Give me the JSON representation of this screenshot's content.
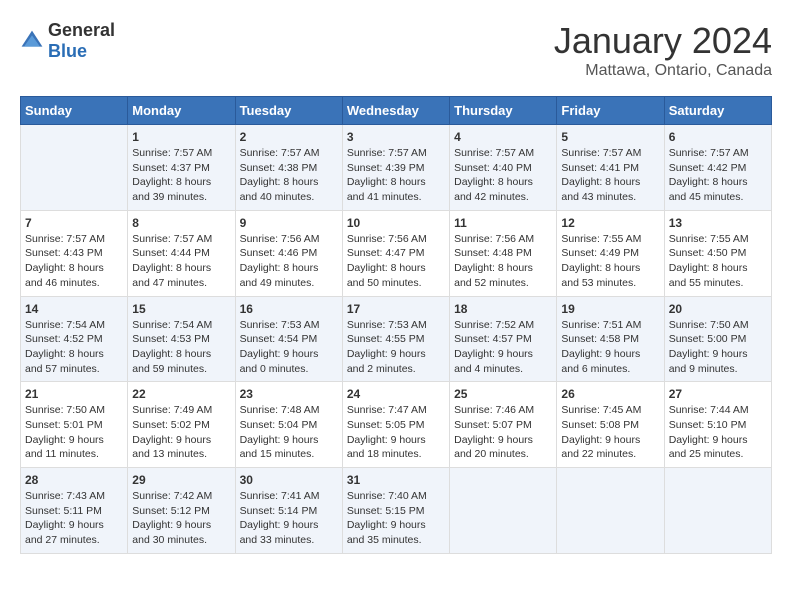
{
  "logo": {
    "general": "General",
    "blue": "Blue"
  },
  "title": "January 2024",
  "subtitle": "Mattawa, Ontario, Canada",
  "days_header": [
    "Sunday",
    "Monday",
    "Tuesday",
    "Wednesday",
    "Thursday",
    "Friday",
    "Saturday"
  ],
  "weeks": [
    [
      {
        "day": "",
        "sunrise": "",
        "sunset": "",
        "daylight": ""
      },
      {
        "day": "1",
        "sunrise": "Sunrise: 7:57 AM",
        "sunset": "Sunset: 4:37 PM",
        "daylight": "Daylight: 8 hours and 39 minutes."
      },
      {
        "day": "2",
        "sunrise": "Sunrise: 7:57 AM",
        "sunset": "Sunset: 4:38 PM",
        "daylight": "Daylight: 8 hours and 40 minutes."
      },
      {
        "day": "3",
        "sunrise": "Sunrise: 7:57 AM",
        "sunset": "Sunset: 4:39 PM",
        "daylight": "Daylight: 8 hours and 41 minutes."
      },
      {
        "day": "4",
        "sunrise": "Sunrise: 7:57 AM",
        "sunset": "Sunset: 4:40 PM",
        "daylight": "Daylight: 8 hours and 42 minutes."
      },
      {
        "day": "5",
        "sunrise": "Sunrise: 7:57 AM",
        "sunset": "Sunset: 4:41 PM",
        "daylight": "Daylight: 8 hours and 43 minutes."
      },
      {
        "day": "6",
        "sunrise": "Sunrise: 7:57 AM",
        "sunset": "Sunset: 4:42 PM",
        "daylight": "Daylight: 8 hours and 45 minutes."
      }
    ],
    [
      {
        "day": "7",
        "sunrise": "Sunrise: 7:57 AM",
        "sunset": "Sunset: 4:43 PM",
        "daylight": "Daylight: 8 hours and 46 minutes."
      },
      {
        "day": "8",
        "sunrise": "Sunrise: 7:57 AM",
        "sunset": "Sunset: 4:44 PM",
        "daylight": "Daylight: 8 hours and 47 minutes."
      },
      {
        "day": "9",
        "sunrise": "Sunrise: 7:56 AM",
        "sunset": "Sunset: 4:46 PM",
        "daylight": "Daylight: 8 hours and 49 minutes."
      },
      {
        "day": "10",
        "sunrise": "Sunrise: 7:56 AM",
        "sunset": "Sunset: 4:47 PM",
        "daylight": "Daylight: 8 hours and 50 minutes."
      },
      {
        "day": "11",
        "sunrise": "Sunrise: 7:56 AM",
        "sunset": "Sunset: 4:48 PM",
        "daylight": "Daylight: 8 hours and 52 minutes."
      },
      {
        "day": "12",
        "sunrise": "Sunrise: 7:55 AM",
        "sunset": "Sunset: 4:49 PM",
        "daylight": "Daylight: 8 hours and 53 minutes."
      },
      {
        "day": "13",
        "sunrise": "Sunrise: 7:55 AM",
        "sunset": "Sunset: 4:50 PM",
        "daylight": "Daylight: 8 hours and 55 minutes."
      }
    ],
    [
      {
        "day": "14",
        "sunrise": "Sunrise: 7:54 AM",
        "sunset": "Sunset: 4:52 PM",
        "daylight": "Daylight: 8 hours and 57 minutes."
      },
      {
        "day": "15",
        "sunrise": "Sunrise: 7:54 AM",
        "sunset": "Sunset: 4:53 PM",
        "daylight": "Daylight: 8 hours and 59 minutes."
      },
      {
        "day": "16",
        "sunrise": "Sunrise: 7:53 AM",
        "sunset": "Sunset: 4:54 PM",
        "daylight": "Daylight: 9 hours and 0 minutes."
      },
      {
        "day": "17",
        "sunrise": "Sunrise: 7:53 AM",
        "sunset": "Sunset: 4:55 PM",
        "daylight": "Daylight: 9 hours and 2 minutes."
      },
      {
        "day": "18",
        "sunrise": "Sunrise: 7:52 AM",
        "sunset": "Sunset: 4:57 PM",
        "daylight": "Daylight: 9 hours and 4 minutes."
      },
      {
        "day": "19",
        "sunrise": "Sunrise: 7:51 AM",
        "sunset": "Sunset: 4:58 PM",
        "daylight": "Daylight: 9 hours and 6 minutes."
      },
      {
        "day": "20",
        "sunrise": "Sunrise: 7:50 AM",
        "sunset": "Sunset: 5:00 PM",
        "daylight": "Daylight: 9 hours and 9 minutes."
      }
    ],
    [
      {
        "day": "21",
        "sunrise": "Sunrise: 7:50 AM",
        "sunset": "Sunset: 5:01 PM",
        "daylight": "Daylight: 9 hours and 11 minutes."
      },
      {
        "day": "22",
        "sunrise": "Sunrise: 7:49 AM",
        "sunset": "Sunset: 5:02 PM",
        "daylight": "Daylight: 9 hours and 13 minutes."
      },
      {
        "day": "23",
        "sunrise": "Sunrise: 7:48 AM",
        "sunset": "Sunset: 5:04 PM",
        "daylight": "Daylight: 9 hours and 15 minutes."
      },
      {
        "day": "24",
        "sunrise": "Sunrise: 7:47 AM",
        "sunset": "Sunset: 5:05 PM",
        "daylight": "Daylight: 9 hours and 18 minutes."
      },
      {
        "day": "25",
        "sunrise": "Sunrise: 7:46 AM",
        "sunset": "Sunset: 5:07 PM",
        "daylight": "Daylight: 9 hours and 20 minutes."
      },
      {
        "day": "26",
        "sunrise": "Sunrise: 7:45 AM",
        "sunset": "Sunset: 5:08 PM",
        "daylight": "Daylight: 9 hours and 22 minutes."
      },
      {
        "day": "27",
        "sunrise": "Sunrise: 7:44 AM",
        "sunset": "Sunset: 5:10 PM",
        "daylight": "Daylight: 9 hours and 25 minutes."
      }
    ],
    [
      {
        "day": "28",
        "sunrise": "Sunrise: 7:43 AM",
        "sunset": "Sunset: 5:11 PM",
        "daylight": "Daylight: 9 hours and 27 minutes."
      },
      {
        "day": "29",
        "sunrise": "Sunrise: 7:42 AM",
        "sunset": "Sunset: 5:12 PM",
        "daylight": "Daylight: 9 hours and 30 minutes."
      },
      {
        "day": "30",
        "sunrise": "Sunrise: 7:41 AM",
        "sunset": "Sunset: 5:14 PM",
        "daylight": "Daylight: 9 hours and 33 minutes."
      },
      {
        "day": "31",
        "sunrise": "Sunrise: 7:40 AM",
        "sunset": "Sunset: 5:15 PM",
        "daylight": "Daylight: 9 hours and 35 minutes."
      },
      {
        "day": "",
        "sunrise": "",
        "sunset": "",
        "daylight": ""
      },
      {
        "day": "",
        "sunrise": "",
        "sunset": "",
        "daylight": ""
      },
      {
        "day": "",
        "sunrise": "",
        "sunset": "",
        "daylight": ""
      }
    ]
  ]
}
